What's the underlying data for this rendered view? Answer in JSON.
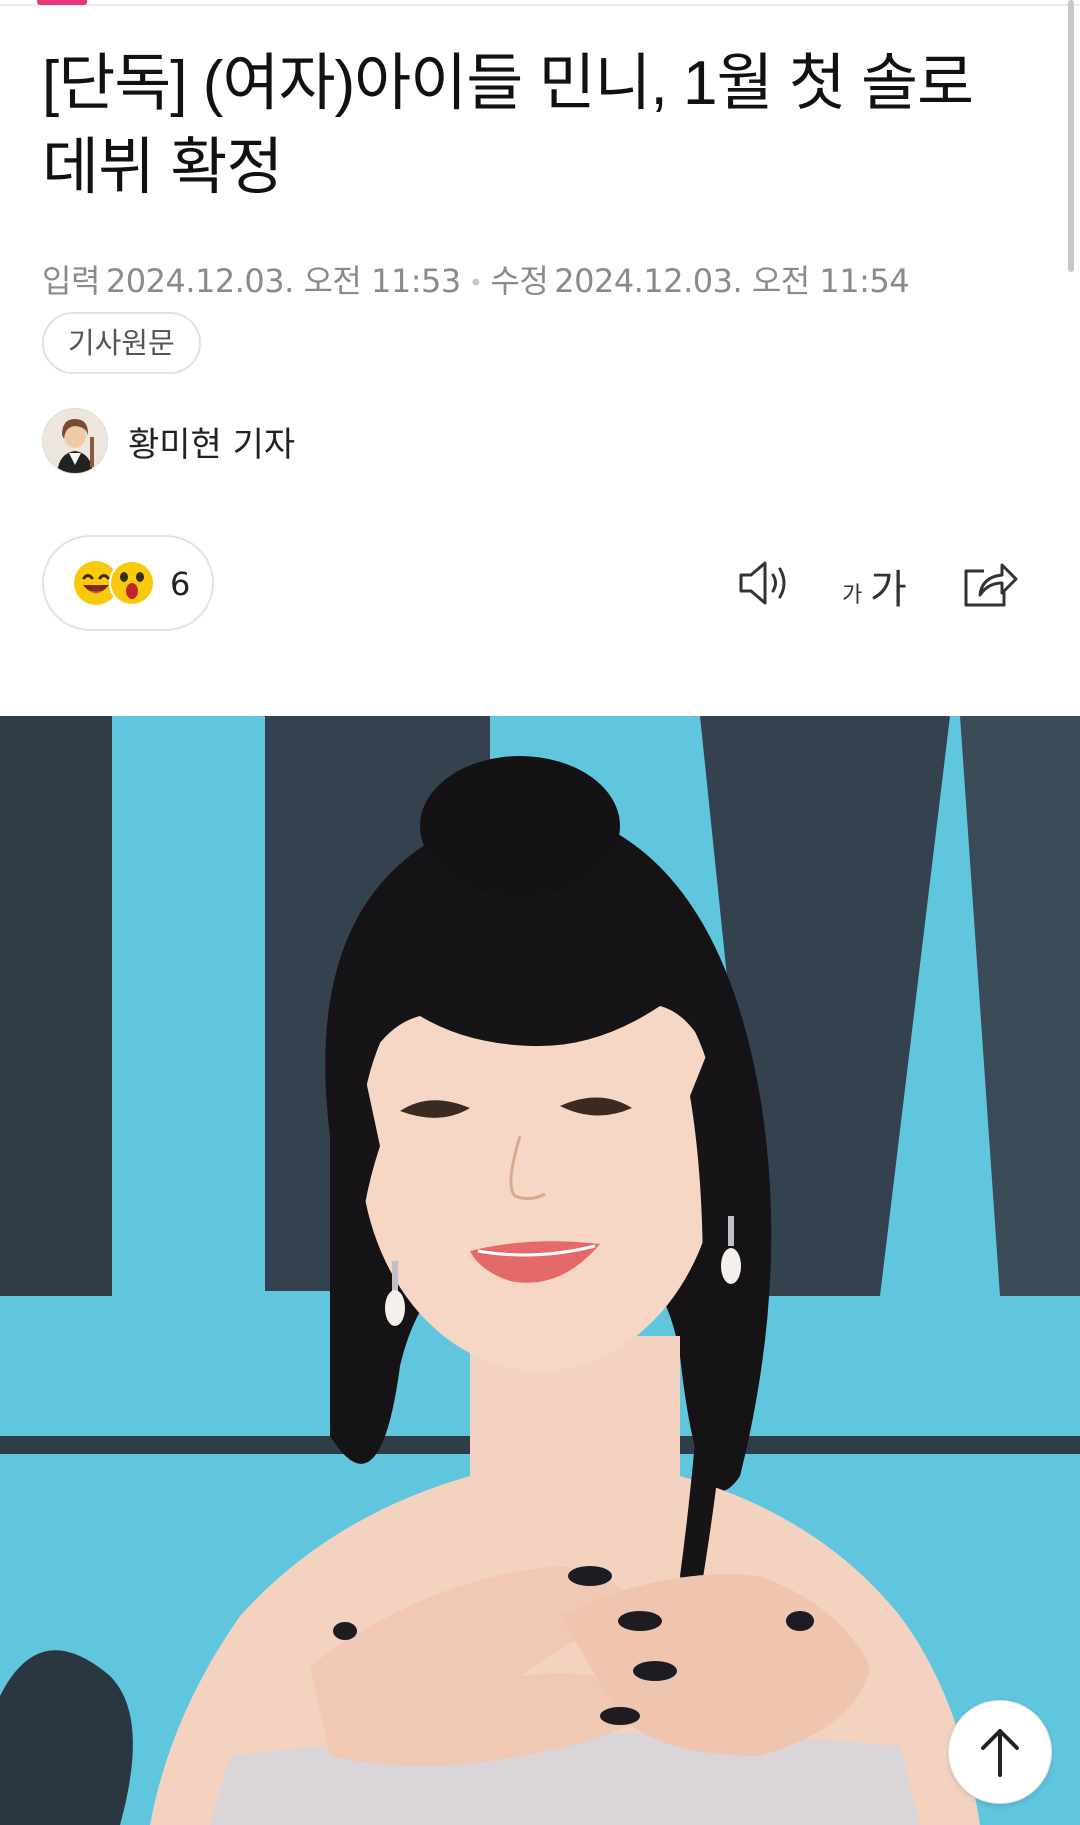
{
  "article": {
    "title": "[단독] (여자)아이들 민니, 1월 첫 솔로 데뷔 확정",
    "published_label": "입력",
    "published_time": "2024.12.03. 오전 11:53",
    "modified_label": "수정",
    "modified_time": "2024.12.03. 오전 11:54",
    "original_button": "기사원문",
    "reporter": "황미현 기자"
  },
  "reactions": {
    "count": "6",
    "emojis": [
      "laughing-face",
      "surprised-face"
    ]
  },
  "toolbar": {
    "speaker_icon": "speaker-icon",
    "font_small": "가",
    "font_large": "가",
    "share_icon": "share-icon"
  },
  "colors": {
    "accent": "#e8367a",
    "backdrop": "#5fc6de",
    "emoji_yellow": "#f9c90d"
  }
}
